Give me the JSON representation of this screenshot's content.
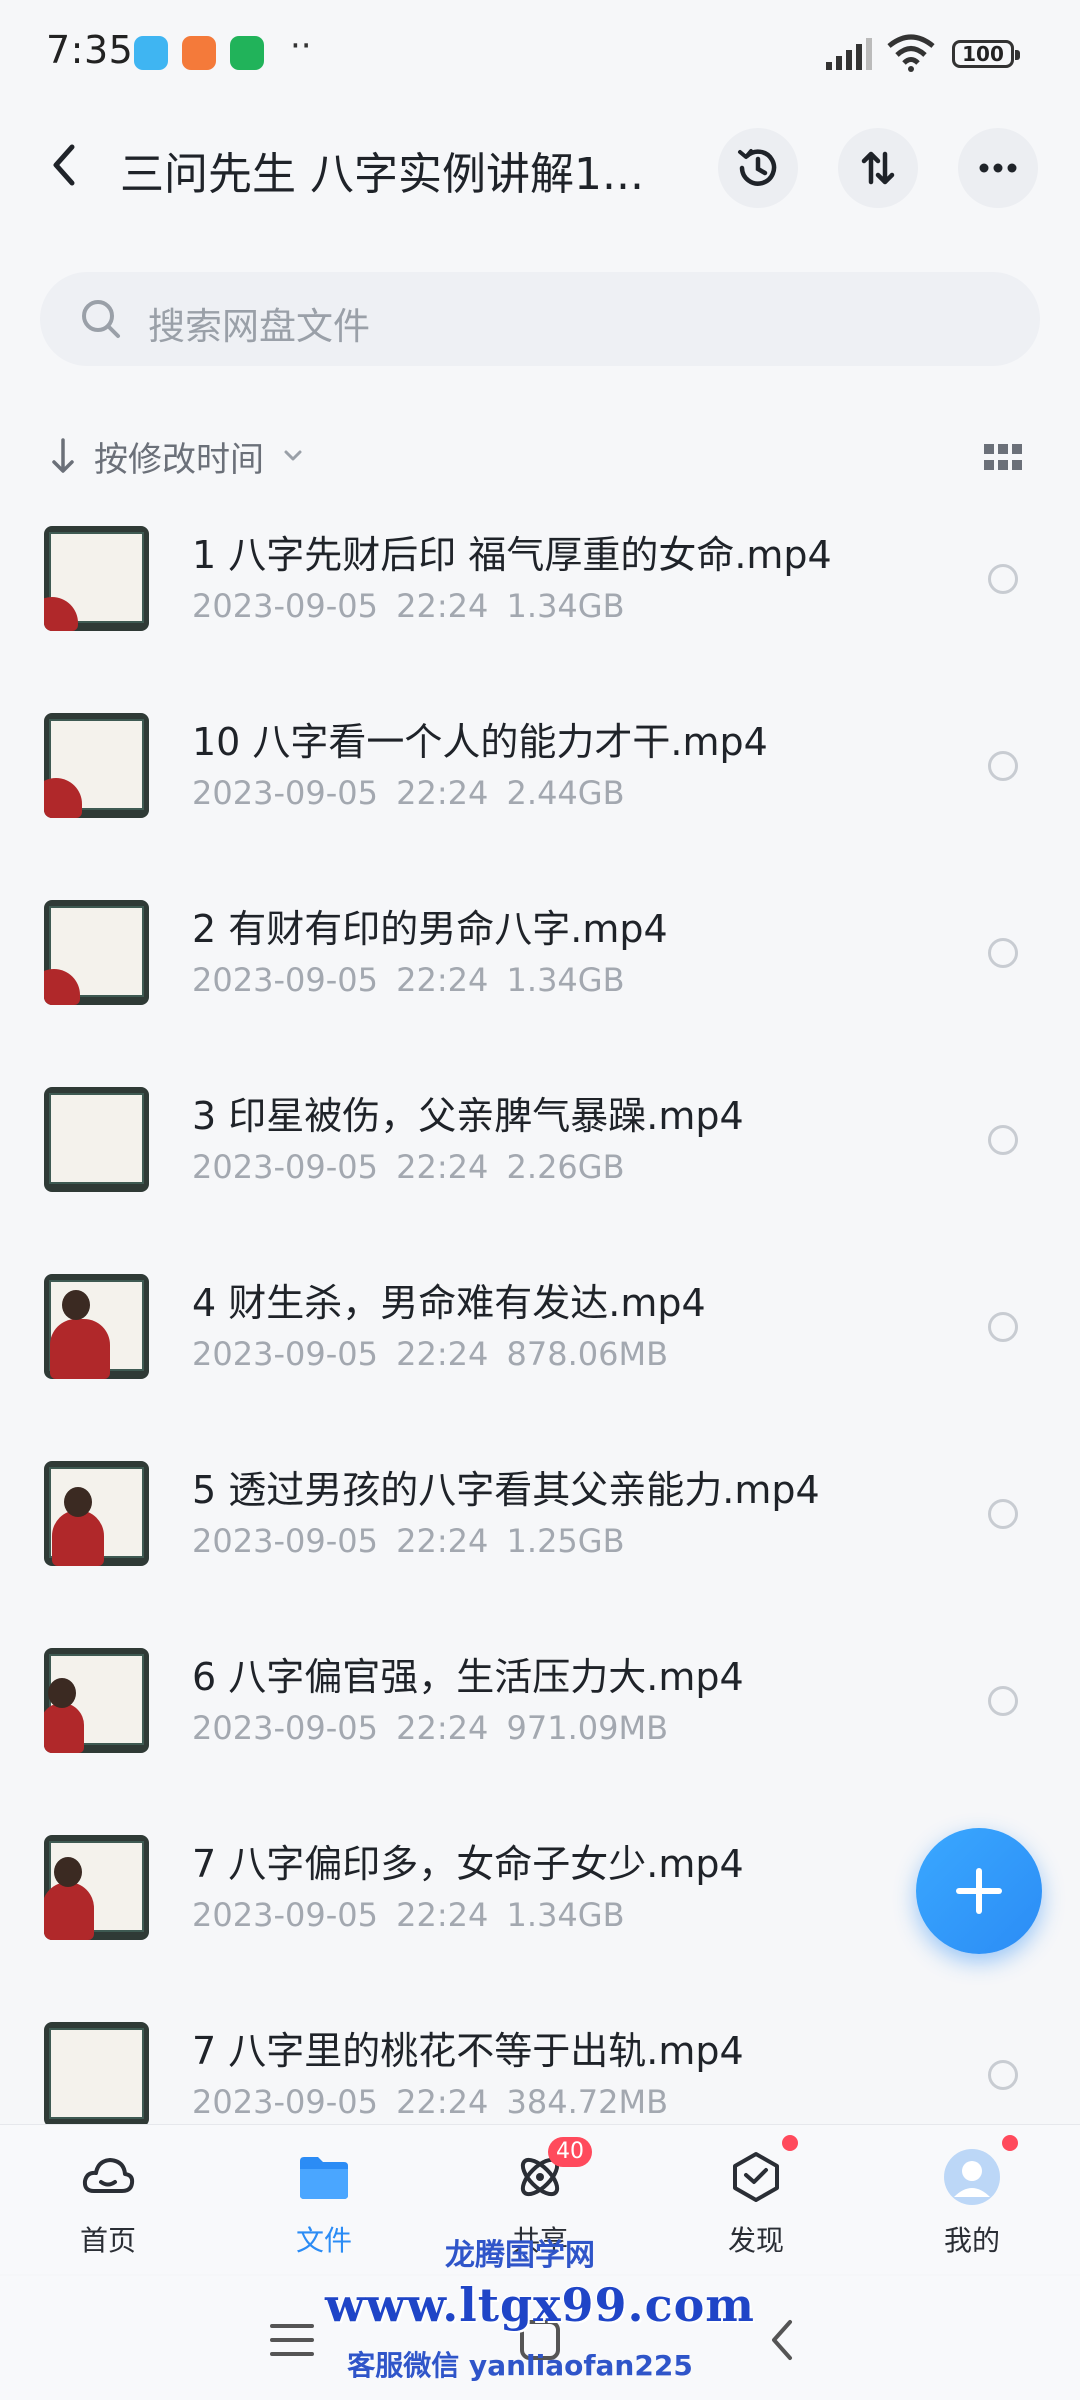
{
  "status_bar": {
    "time": "7:35",
    "dots": "··",
    "battery": "100"
  },
  "header": {
    "title": "三问先生 八字实例讲解1...",
    "back_icon": "chevron-left-icon",
    "history_icon": "history-clock-icon",
    "transfer_icon": "transfer-arrows-icon",
    "more_icon": "more-dots-icon"
  },
  "search": {
    "placeholder": "搜索网盘文件"
  },
  "sort": {
    "label": "按修改时间"
  },
  "files": [
    {
      "name": "1 八字先财后印 福气厚重的女命.mp4",
      "date": "2023-09-05",
      "time": "22:24",
      "size": "1.34GB"
    },
    {
      "name": "10 八字看一个人的能力才干.mp4",
      "date": "2023-09-05",
      "time": "22:24",
      "size": "2.44GB"
    },
    {
      "name": "2 有财有印的男命八字.mp4",
      "date": "2023-09-05",
      "time": "22:24",
      "size": "1.34GB"
    },
    {
      "name": "3 印星被伤，父亲脾气暴躁.mp4",
      "date": "2023-09-05",
      "time": "22:24",
      "size": "2.26GB"
    },
    {
      "name": "4 财生杀，男命难有发达.mp4",
      "date": "2023-09-05",
      "time": "22:24",
      "size": "878.06MB"
    },
    {
      "name": "5 透过男孩的八字看其父亲能力.mp4",
      "date": "2023-09-05",
      "time": "22:24",
      "size": "1.25GB"
    },
    {
      "name": "6 八字偏官强，生活压力大.mp4",
      "date": "2023-09-05",
      "time": "22:24",
      "size": "971.09MB"
    },
    {
      "name": "7 八字偏印多，女命子女少.mp4",
      "date": "2023-09-05",
      "time": "22:24",
      "size": "1.34GB"
    },
    {
      "name": "7 八字里的桃花不等于出轨.mp4",
      "date": "2023-09-05",
      "time": "22:24",
      "size": "384.72MB"
    }
  ],
  "bottom_nav": {
    "items": [
      {
        "label": "首页",
        "icon": "home-cloud-icon"
      },
      {
        "label": "文件",
        "icon": "folder-icon"
      },
      {
        "label": "共享",
        "icon": "share-orbit-icon",
        "badge": "40"
      },
      {
        "label": "发现",
        "icon": "discover-cube-icon"
      },
      {
        "label": "我的",
        "icon": "avatar-icon"
      }
    ]
  },
  "watermark": {
    "line1": "龙腾国学网",
    "line2": "www.ltgx99.com",
    "line3": "客服微信 yanliaofan225"
  },
  "colors": {
    "accent": "#2b8cf5",
    "badge": "#ff4a5c",
    "background": "#f6f7f9"
  }
}
